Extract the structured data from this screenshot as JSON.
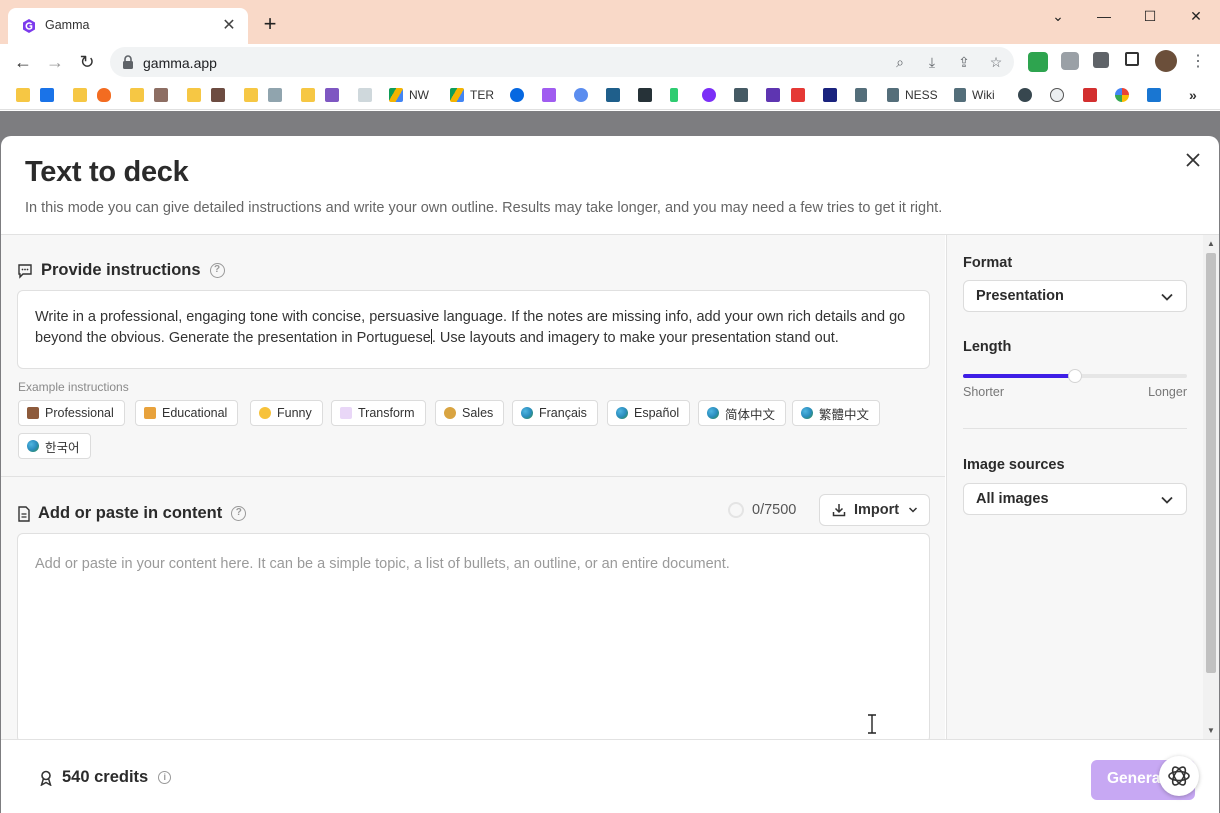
{
  "browser": {
    "tab_title": "Gamma",
    "url": "gamma.app",
    "bookmarks": [
      "NW",
      "TER",
      "NESS",
      "Wiki"
    ]
  },
  "modal": {
    "title": "Text to deck",
    "subtitle": "In this mode you can give detailed instructions and write your own outline. Results may take longer, and you may need a few tries to get it right."
  },
  "instructions": {
    "heading": "Provide instructions",
    "text_before_caret": "Write in a professional, engaging tone with concise, persuasive language. If the notes are missing info, add your own rich details and go beyond the obvious. Generate the presentation in Portuguese",
    "text_after_caret": ". Use layouts and imagery to make your presentation stand out.",
    "examples_label": "Example instructions",
    "examples": [
      "Professional",
      "Educational",
      "Funny",
      "Transform",
      "Sales",
      "Français",
      "Español",
      "简体中文",
      "繁體中文",
      "한국어"
    ]
  },
  "content": {
    "heading": "Add or paste in content",
    "char_count": "0/7500",
    "import_label": "Import",
    "placeholder": "Add or paste in your content here. It can be a simple topic, a list of bullets, an outline, or an entire document."
  },
  "settings": {
    "format_label": "Format",
    "format_value": "Presentation",
    "length_label": "Length",
    "length_level": 0.5,
    "length_min_label": "Shorter",
    "length_max_label": "Longer",
    "image_sources_label": "Image sources",
    "image_sources_value": "All images"
  },
  "footer": {
    "credits": "540 credits",
    "generate_label": "Generate"
  },
  "colors": {
    "accent": "#3e1ee6",
    "generate_bg": "#c7a8f3",
    "titlebar": "#f9d9c8"
  }
}
